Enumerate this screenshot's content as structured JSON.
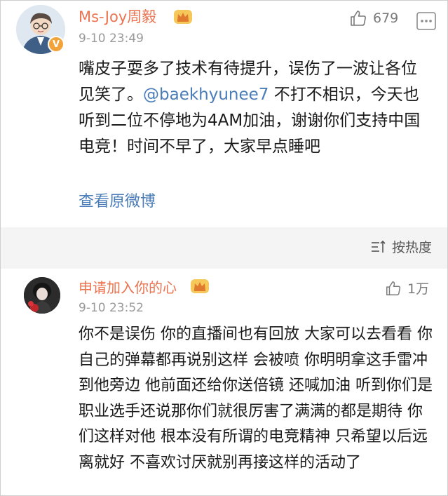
{
  "post": {
    "username": "Ms-Joy周毅",
    "time": "9-10 23:49",
    "likes": "679",
    "badge": "V",
    "text_part1": "嘴皮子耍多了技术有待提升，误伤了一波让各位见笑了。",
    "mention": "@baekhyunee7",
    "text_part2": " 不打不相识，今天也听到二位不停地为4AM加油，谢谢你们支持中国电竞！时间不早了，大家早点睡吧",
    "view_original": "查看原微博"
  },
  "sort": {
    "label": "按热度"
  },
  "reply": {
    "username": "申请加入你的心",
    "time": "9-10 23:52",
    "likes": "1万",
    "text": "你不是误伤 你的直播间也有回放 大家可以去看看 你自己的弹幕都再说别这样 会被喷 你明明拿这手雷冲到他旁边 他前面还给你送倍镜 还喊加油 听到你们是职业选手还说那你们就很厉害了满满的都是期待 你们这样对他 根本没有所谓的电竞精神 只希望以后远离就好 不喜欢讨厌就别再接这样的活动了"
  },
  "colors": {
    "username": "#eb7350",
    "link": "#4a7db8",
    "meta": "#9a9a9a",
    "gap": "#f4f4f4"
  },
  "icons": [
    "thumbs-up-icon",
    "more-dots-icon",
    "crown-icon",
    "verified-badge-icon",
    "sort-icon"
  ]
}
